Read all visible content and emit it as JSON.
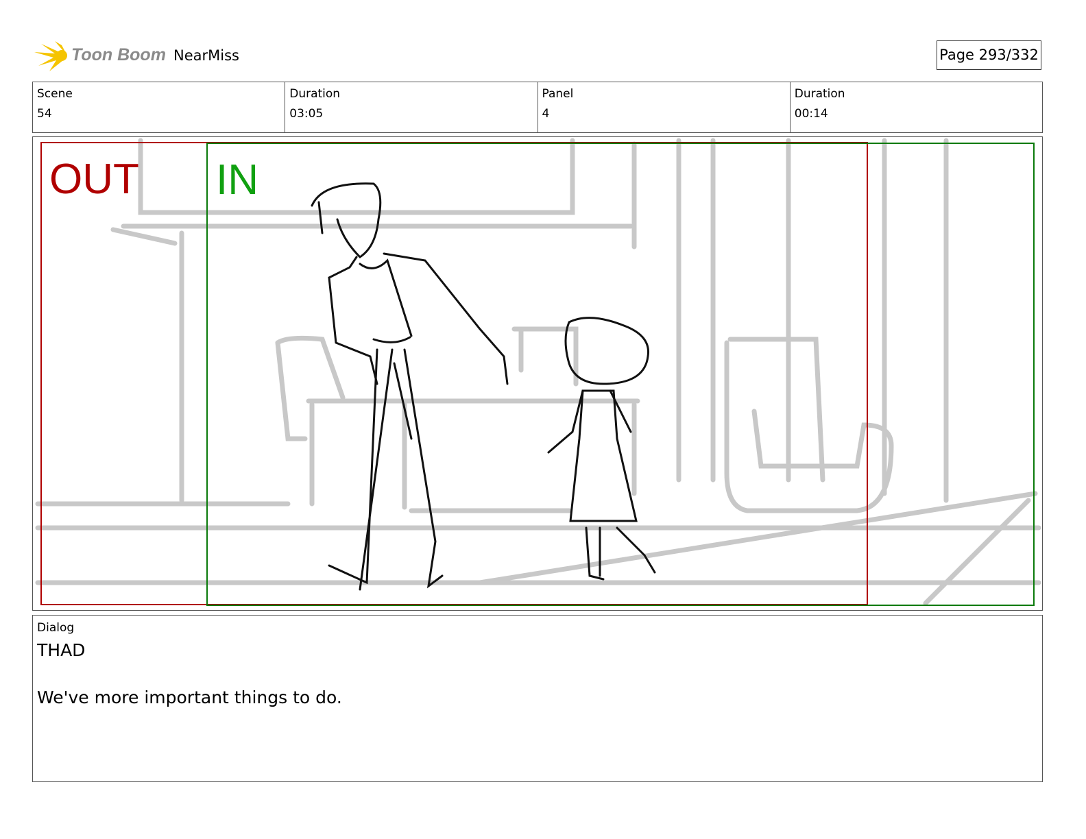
{
  "header": {
    "logo_text": "Toon Boom",
    "project": "NearMiss",
    "page": "Page 293/332"
  },
  "info": [
    {
      "label": "Scene",
      "value": "54"
    },
    {
      "label": "Duration",
      "value": "03:05"
    },
    {
      "label": "Panel",
      "value": "4"
    },
    {
      "label": "Duration",
      "value": "00:14"
    }
  ],
  "panel": {
    "out_label": "OUT",
    "in_label": "IN",
    "colors": {
      "out": "#b00000",
      "in": "#009900",
      "sketch_bg": "#c8c8c8",
      "sketch_fg": "#111111"
    }
  },
  "dialog": {
    "label": "Dialog",
    "character": "THAD",
    "line": "We've more important things to do."
  }
}
